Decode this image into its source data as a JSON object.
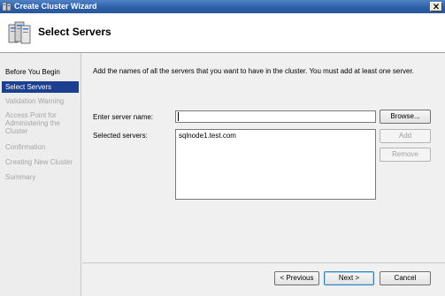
{
  "window": {
    "title": "Create Cluster Wizard",
    "close_glyph": "x"
  },
  "header": {
    "title": "Select Servers"
  },
  "nav": {
    "items": [
      {
        "label": "Before You Begin",
        "state": "done"
      },
      {
        "label": "Select Servers",
        "state": "active"
      },
      {
        "label": "Validation Warning",
        "state": "pending"
      },
      {
        "label": "Access Point for\nAdministering the\nCluster",
        "state": "pending"
      },
      {
        "label": "Confirmation",
        "state": "pending"
      },
      {
        "label": "Creating New Cluster",
        "state": "pending"
      },
      {
        "label": "Summary",
        "state": "pending"
      }
    ]
  },
  "main": {
    "instruction": "Add the names of all the servers that you want to have in the cluster. You must add at least one server.",
    "server_name_label": "Enter server name:",
    "server_name_value": "",
    "selected_servers_label": "Selected servers:",
    "selected_servers": [
      "sqlnode1.test.com"
    ],
    "browse_label": "Browse...",
    "add_label": "Add",
    "remove_label": "Remove"
  },
  "footer": {
    "previous_label": "< Previous",
    "next_label": "Next >",
    "cancel_label": "Cancel"
  },
  "colors": {
    "titlebar": "#2c5ea8",
    "nav_active": "#1c3f8f",
    "nav_pending_text": "#a5a5a5",
    "background": "#f0f0f0"
  }
}
